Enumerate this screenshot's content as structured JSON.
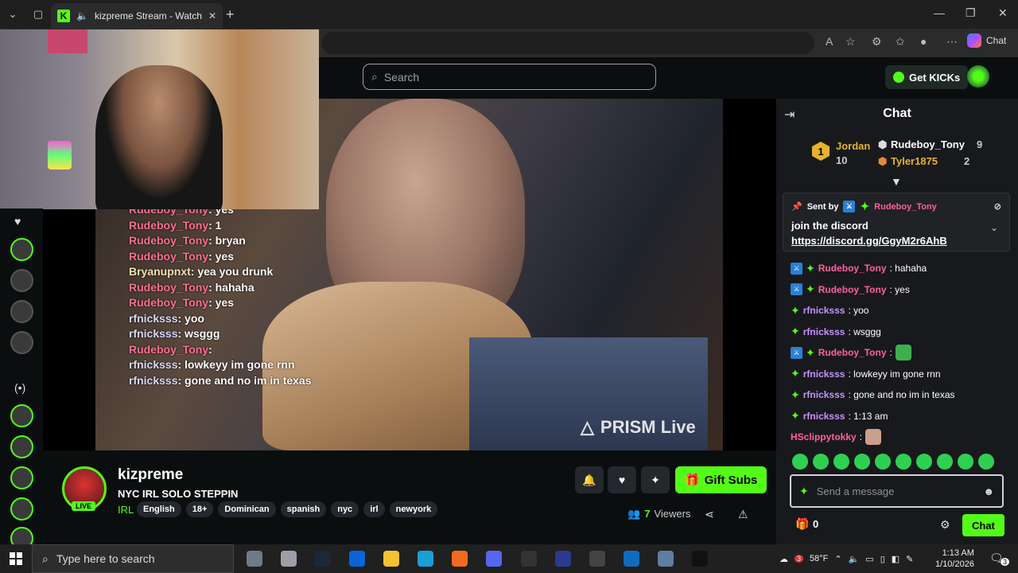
{
  "browser": {
    "tab_title": "kizpreme Stream - Watch Live",
    "copilot_label": "Chat"
  },
  "header": {
    "search_placeholder": "Search",
    "get_kicks_label": "Get KICKs"
  },
  "video": {
    "overlay_chat": [
      {
        "user": "Rudeboy_Tony",
        "text": ": yes",
        "style": "u1"
      },
      {
        "user": "Rudeboy_Tony",
        "text": ": 1",
        "style": "u1"
      },
      {
        "user": "Rudeboy_Tony",
        "text": ": bryan",
        "style": "u1"
      },
      {
        "user": "Rudeboy_Tony",
        "text": ": yes",
        "style": "u1"
      },
      {
        "user": "Bryanupnxt",
        "text": ": yea you drunk",
        "style": "u3"
      },
      {
        "user": "Rudeboy_Tony",
        "text": ": hahaha",
        "style": "u1"
      },
      {
        "user": "Rudeboy_Tony",
        "text": ": yes",
        "style": "u1"
      },
      {
        "user": "rfnicksss",
        "text": ": yoo",
        "style": "u2"
      },
      {
        "user": "rfnicksss",
        "text": ": wsggg",
        "style": "u2"
      },
      {
        "user": "Rudeboy_Tony",
        "text": ":",
        "style": "u1"
      },
      {
        "user": "rfnicksss",
        "text": ": lowkeyy im gone rnn",
        "style": "u2"
      },
      {
        "user": "rfnicksss",
        "text": ": gone and no im in texas",
        "style": "u2"
      }
    ],
    "watermark": "PRISM Live"
  },
  "stream": {
    "streamer": "kizpreme",
    "title": "NYC IRL SOLO STEPPIN",
    "live_badge": "LIVE",
    "category": "IRL",
    "tags": [
      "English",
      "18+",
      "Dominican",
      "spanish",
      "nyc",
      "irl",
      "newyork"
    ],
    "gift_subs_label": "Gift Subs",
    "viewer_count": "7",
    "viewers_label": "Viewers"
  },
  "chat": {
    "title": "Chat",
    "leaderboard": {
      "rank1_badge": "1",
      "rank1_name": "Jordan",
      "rank1_value": "10",
      "rank2_name": "Rudeboy_Tony",
      "rank2_value": "9",
      "rank3_name": "Tyler1875",
      "rank3_value": "2"
    },
    "pinned": {
      "sent_by_label": "Sent by",
      "sender": "Rudeboy_Tony",
      "message": "join the discord",
      "link": "https://discord.gg/GgyM2r6AhB"
    },
    "messages": [
      {
        "user": "Rudeboy_Tony",
        "text": ": hahaha",
        "mod": true
      },
      {
        "user": "Rudeboy_Tony",
        "text": ": yes",
        "mod": true
      },
      {
        "user": "rfnicksss",
        "text": ": yoo",
        "mod": false
      },
      {
        "user": "rfnicksss",
        "text": ": wsggg",
        "mod": false
      },
      {
        "user": "Rudeboy_Tony",
        "text": ":",
        "mod": true
      },
      {
        "user": "rfnicksss",
        "text": ": lowkeyy im gone rnn",
        "mod": false
      },
      {
        "user": "rfnicksss",
        "text": ": gone and no im in texas",
        "mod": false
      },
      {
        "user": "rfnicksss",
        "text": ": 1:13 am",
        "mod": false
      },
      {
        "user": "HSclippytokky",
        "text": ":",
        "mod": false,
        "plain": true
      }
    ],
    "input_placeholder": "Send a message",
    "points": "0",
    "send_label": "Chat"
  },
  "taskbar": {
    "search_placeholder": "Type here to search",
    "weather": "58°F",
    "weather_badge": "3",
    "time": "1:13 AM",
    "date": "1/10/2026",
    "notification_count": "3"
  }
}
